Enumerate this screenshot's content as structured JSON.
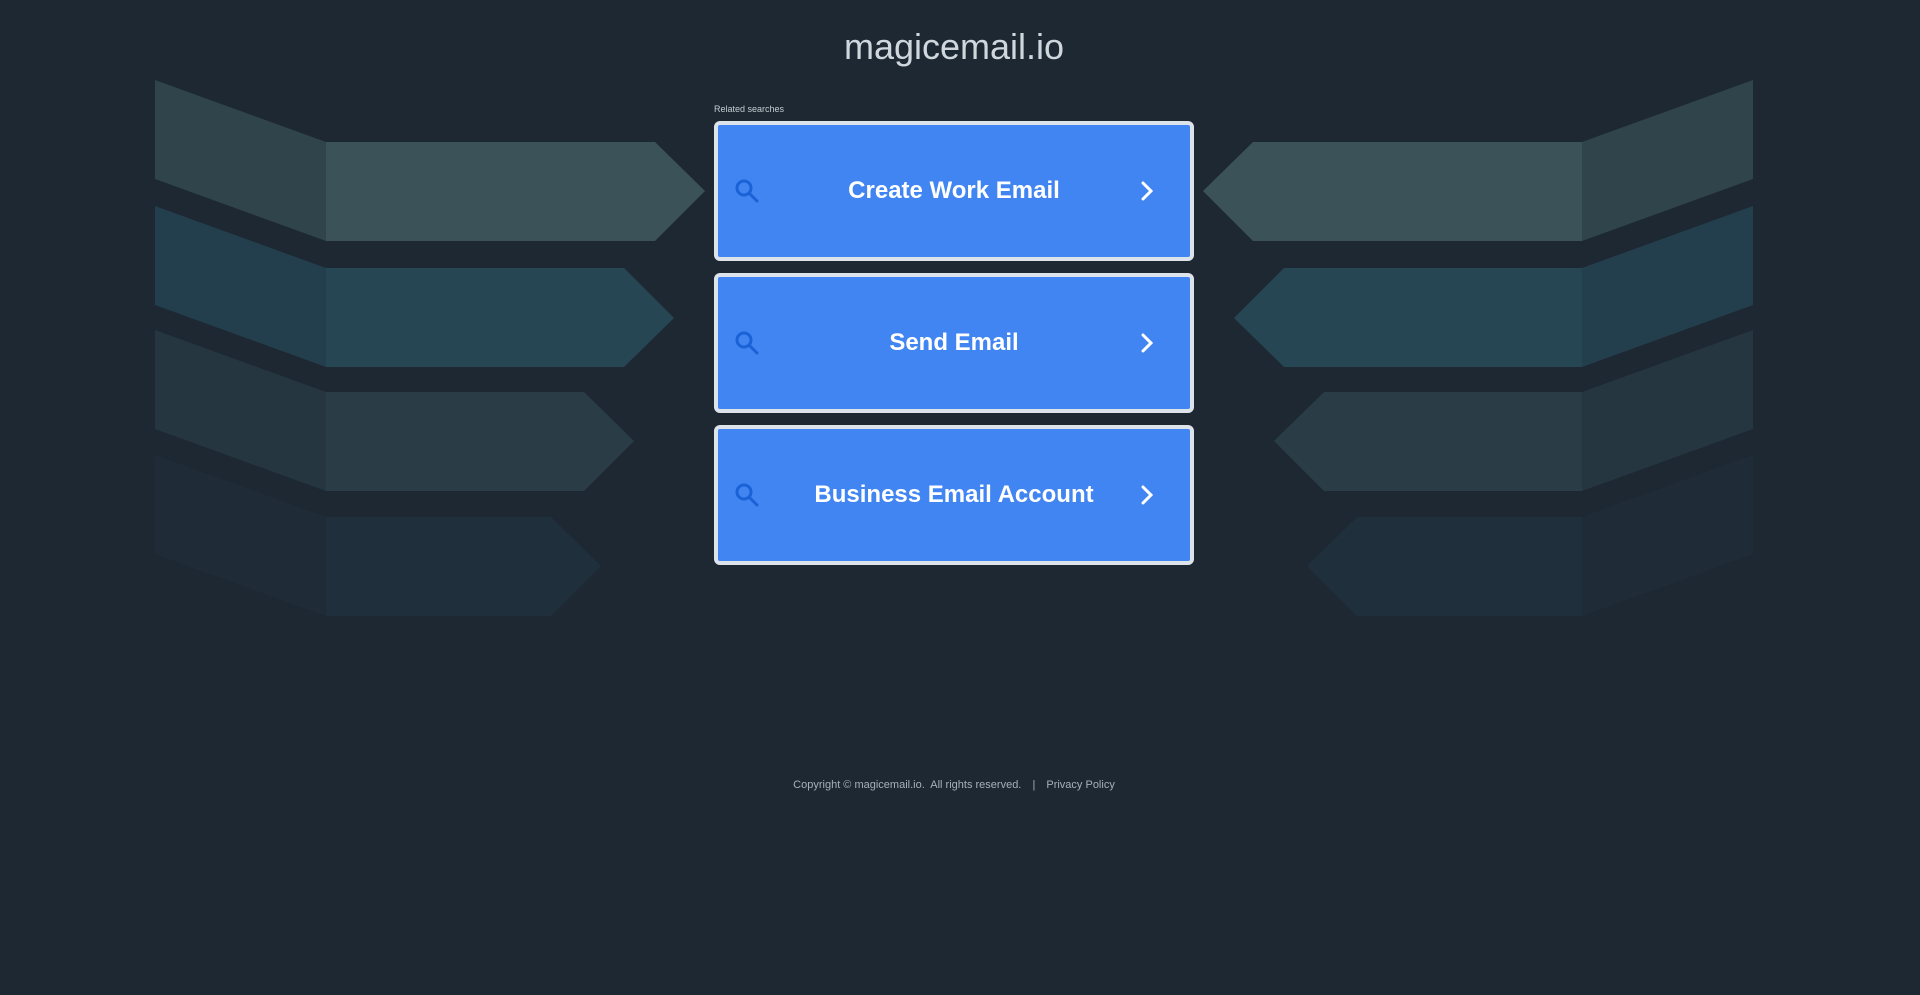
{
  "header": {
    "title": "magicemail.io"
  },
  "related": {
    "heading": "Related searches",
    "items": [
      {
        "label": "Create Work Email",
        "icon": "search-icon",
        "arrow": "chevron-right-icon"
      },
      {
        "label": "Send Email",
        "icon": "search-icon",
        "arrow": "chevron-right-icon"
      },
      {
        "label": "Business Email Account",
        "icon": "search-icon",
        "arrow": "chevron-right-icon"
      }
    ]
  },
  "footer": {
    "copyright": "Copyright © magicemail.io.  All rights reserved.",
    "separator": "|",
    "privacy": "Privacy Policy"
  },
  "colors": {
    "background": "#1e2833",
    "button": "#4185f3",
    "button_border": "#dde3ea",
    "icon": "#1a62d6"
  }
}
